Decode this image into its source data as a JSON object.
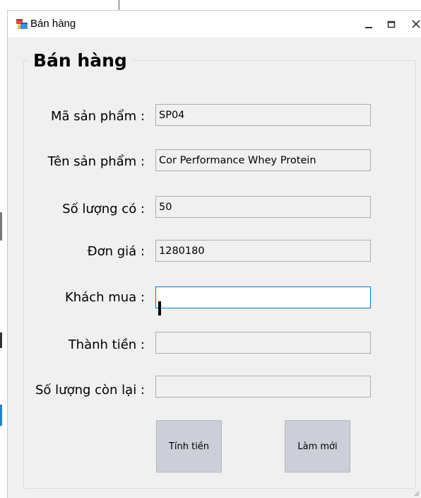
{
  "window": {
    "title": "Bán hàng",
    "icons": [
      "app-form-icon",
      "minimize-icon",
      "maximize-icon",
      "close-icon",
      "resize-grip-icon"
    ]
  },
  "form": {
    "group_title": "Bán hàng",
    "fields": {
      "product_code": {
        "label": "Mã sản phẩm :",
        "value": "SP04"
      },
      "product_name": {
        "label": "Tên sản phẩm :",
        "value": "Cor Performance Whey Protein"
      },
      "quantity_available": {
        "label": "Số lượng có :",
        "value": "50"
      },
      "unit_price": {
        "label": "Đơn giá :",
        "value": "1280180"
      },
      "customer": {
        "label": "Khách mua :",
        "value": ""
      },
      "total": {
        "label": "Thành tiền :",
        "value": ""
      },
      "quantity_remaining": {
        "label": "Số lượng còn lại :",
        "value": ""
      }
    },
    "buttons": {
      "calculate": "Tính tiền",
      "reset": "Làm mới"
    }
  },
  "colors": {
    "window_bg": "#f0f0f0",
    "titlebar_bg": "#ffffff",
    "field_bg": "#f0f0f0",
    "focus_border": "#0078d7",
    "button_bg": "#cccfd8"
  }
}
